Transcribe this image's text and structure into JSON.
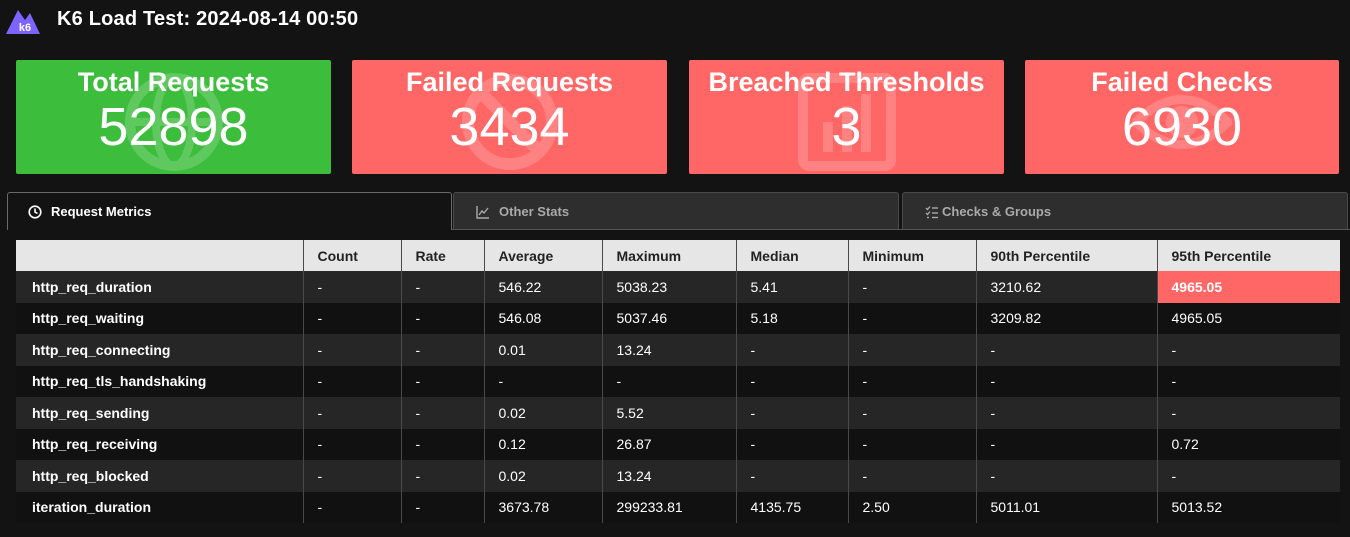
{
  "header": {
    "logo_text": "k6",
    "title": "K6 Load Test: 2024-08-14 00:50"
  },
  "colors": {
    "success": "#3cbd3c",
    "failure": "#ff6666",
    "logo": "#7d64ff"
  },
  "cards": [
    {
      "label": "Total Requests",
      "value": "52898",
      "status": "success",
      "icon": "globe-icon"
    },
    {
      "label": "Failed Requests",
      "value": "3434",
      "status": "failure",
      "icon": "no-entry-icon"
    },
    {
      "label": "Breached Thresholds",
      "value": "3",
      "status": "failure",
      "icon": "chart-icon"
    },
    {
      "label": "Failed Checks",
      "value": "6930",
      "status": "failure",
      "icon": "eye-icon"
    }
  ],
  "tabs": [
    {
      "label": "Request Metrics",
      "icon": "clock-icon",
      "active": true
    },
    {
      "label": "Other Stats",
      "icon": "line-chart-icon",
      "active": false
    },
    {
      "label": "Checks & Groups",
      "icon": "checklist-icon",
      "active": false
    }
  ],
  "table": {
    "columns": [
      "",
      "Count",
      "Rate",
      "Average",
      "Maximum",
      "Median",
      "Minimum",
      "90th Percentile",
      "95th Percentile"
    ],
    "rows": [
      [
        "http_req_duration",
        "-",
        "-",
        "546.22",
        "5038.23",
        "5.41",
        "-",
        "3210.62",
        "4965.05"
      ],
      [
        "http_req_waiting",
        "-",
        "-",
        "546.08",
        "5037.46",
        "5.18",
        "-",
        "3209.82",
        "4965.05"
      ],
      [
        "http_req_connecting",
        "-",
        "-",
        "0.01",
        "13.24",
        "-",
        "-",
        "-",
        "-"
      ],
      [
        "http_req_tls_handshaking",
        "-",
        "-",
        "-",
        "-",
        "-",
        "-",
        "-",
        "-"
      ],
      [
        "http_req_sending",
        "-",
        "-",
        "0.02",
        "5.52",
        "-",
        "-",
        "-",
        "-"
      ],
      [
        "http_req_receiving",
        "-",
        "-",
        "0.12",
        "26.87",
        "-",
        "-",
        "-",
        "0.72"
      ],
      [
        "http_req_blocked",
        "-",
        "-",
        "0.02",
        "13.24",
        "-",
        "-",
        "-",
        "-"
      ],
      [
        "iteration_duration",
        "-",
        "-",
        "3673.78",
        "299233.81",
        "4135.75",
        "2.50",
        "5011.01",
        "5013.52"
      ]
    ],
    "breached_cells": [
      {
        "row": 0,
        "col": 8
      }
    ]
  }
}
